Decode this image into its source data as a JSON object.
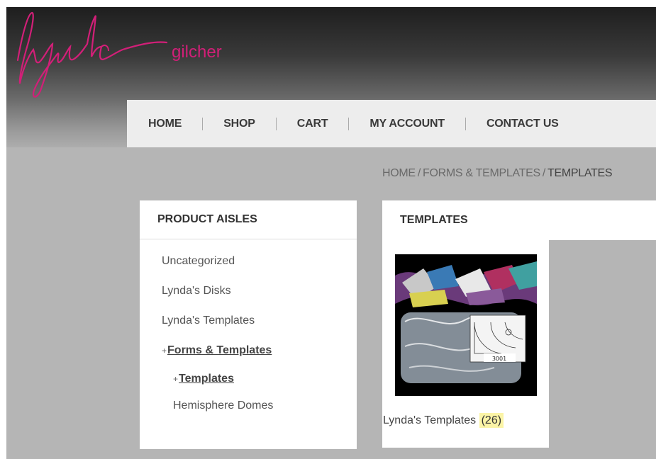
{
  "logo": {
    "script": "Lynda",
    "sub": "gilcher"
  },
  "nav": {
    "items": [
      "HOME",
      "SHOP",
      "CART",
      "MY ACCOUNT",
      "CONTACT US"
    ]
  },
  "breadcrumb": {
    "home": "HOME",
    "sep": "/",
    "parent": "FORMS & TEMPLATES",
    "current": "TEMPLATES"
  },
  "sidebar": {
    "title": "PRODUCT AISLES",
    "items": [
      "Uncategorized",
      "Lynda's Disks",
      "Lynda's Templates"
    ],
    "active_parent": "Forms & Templates",
    "active_child": "Templates",
    "sub_item": "Hemisphere Domes",
    "plus": "+"
  },
  "main": {
    "title": "TEMPLATES",
    "product": {
      "name": "Lynda's Templates",
      "count": "(26)",
      "image_label": "3001"
    }
  },
  "colors": {
    "brand": "#d21f78",
    "background": "#b5b5b5",
    "count_highlight": "#fbf4a6"
  }
}
